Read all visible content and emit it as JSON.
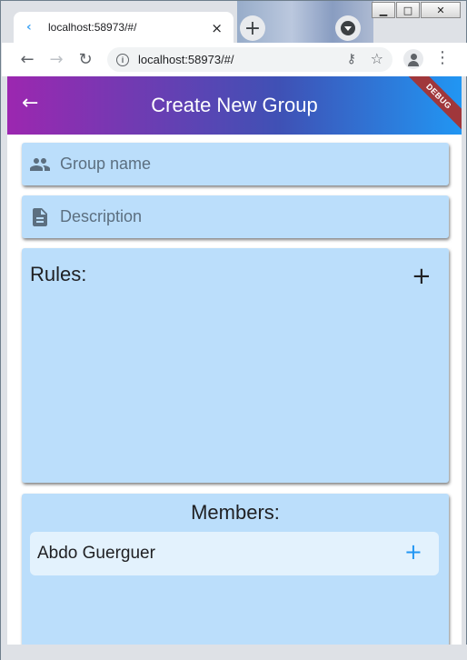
{
  "browser": {
    "tab_title": "localhost:58973/#/",
    "tab_close": "×",
    "new_tab": "+",
    "url": "localhost:58973/#/",
    "window_controls": {
      "minimize": "▁",
      "maximize": "□",
      "close": "✕"
    }
  },
  "app": {
    "title": "Create New Group",
    "debug_banner": "DEBUG",
    "group_name_placeholder": "Group name",
    "description_placeholder": "Description",
    "rules_label": "Rules:",
    "rules_add": "+",
    "members_label": "Members:",
    "members": [
      {
        "name": "Abdo Guerguer",
        "action": "+"
      }
    ]
  },
  "colors": {
    "appbar_start": "#9c27b0",
    "appbar_end": "#2196f3",
    "card_bg": "#bbdefb",
    "member_row_bg": "#e3f2fd",
    "accent": "#2196f3"
  },
  "icons": {
    "back": "arrow-left-icon",
    "group": "people-icon",
    "description": "document-icon",
    "add": "plus-icon"
  }
}
